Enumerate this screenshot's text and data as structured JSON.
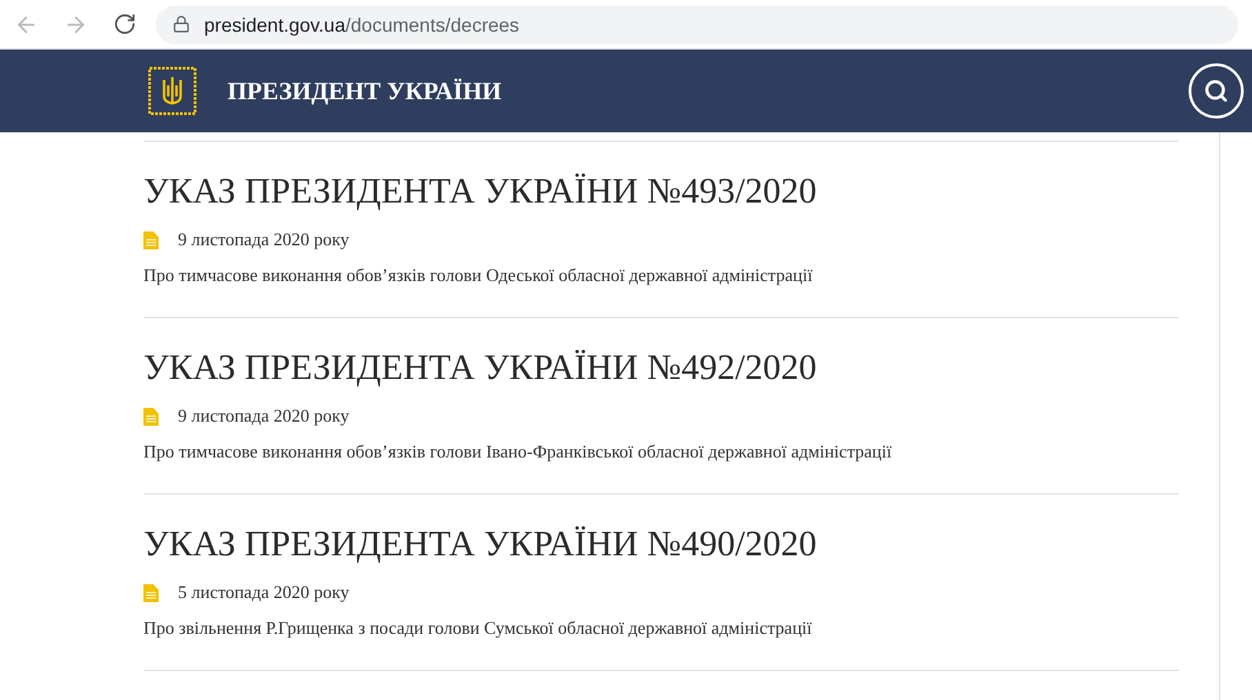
{
  "browser": {
    "url_domain": "president.gov.ua",
    "url_path": "/documents/decrees"
  },
  "header": {
    "title": "ПРЕЗИДЕНТ УКРАЇНИ"
  },
  "decrees": [
    {
      "title": "УКАЗ ПРЕЗИДЕНТА УКРАЇНИ №493/2020",
      "date": "9 листопада 2020 року",
      "description": "Про тимчасове виконання обов’язків голови Одеської обласної державної адміністрації"
    },
    {
      "title": "УКАЗ ПРЕЗИДЕНТА УКРАЇНИ №492/2020",
      "date": "9 листопада 2020 року",
      "description": "Про тимчасове виконання обов’язків голови Івано-Франківської обласної державної адміністрації"
    },
    {
      "title": "УКАЗ ПРЕЗИДЕНТА УКРАЇНИ №490/2020",
      "date": "5 листопада 2020 року",
      "description": "Про звільнення Р.Грищенка з посади голови Сумської обласної державної адміністрації"
    }
  ]
}
